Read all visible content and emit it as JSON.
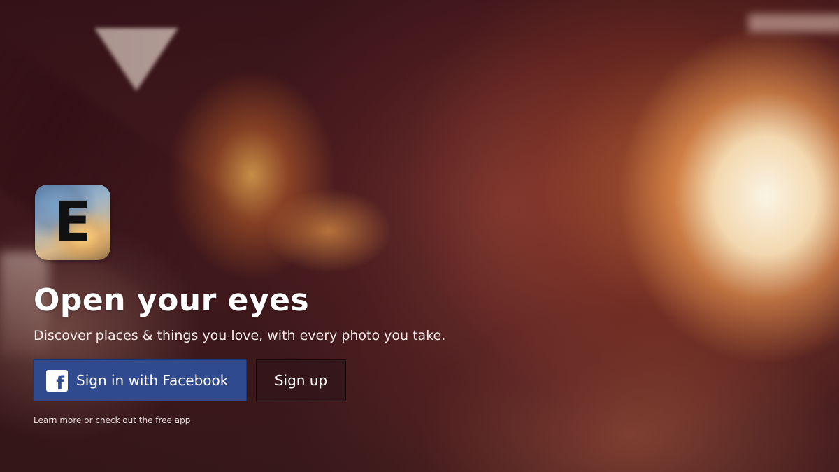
{
  "logo": {
    "letter": "E",
    "icon": "app-logo-icon"
  },
  "hero": {
    "headline": "Open your eyes",
    "tagline": "Discover places & things you love, with every photo you take."
  },
  "actions": {
    "facebook_label": "Sign in with Facebook",
    "facebook_icon_glyph": "f",
    "facebook_icon": "facebook-icon",
    "signup_label": "Sign up"
  },
  "footer": {
    "learn_more": "Learn more",
    "separator": " or ",
    "free_app": "check out the free app"
  },
  "colors": {
    "facebook_blue": "#2f4a8f",
    "signup_bg": "#32161a",
    "text": "#ffffff"
  }
}
